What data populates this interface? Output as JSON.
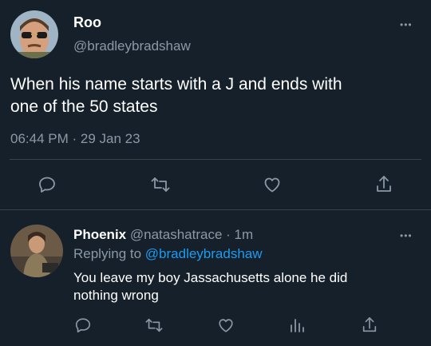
{
  "main_tweet": {
    "author_name": "Roo",
    "author_handle": "@bradleybradshaw",
    "text_line1": "When his name starts with a J and ends with",
    "text_line2": "one of the 50 states",
    "time": "06:44 PM",
    "separator": "·",
    "date": "29 Jan 23",
    "more_label": "•••"
  },
  "reply": {
    "author_name": "Phoenix",
    "author_handle": "@natashatrace",
    "separator": "·",
    "time_ago": "1m",
    "replying_prefix": "Replying to",
    "replying_to": "@bradleybradshaw",
    "text_line1": "You leave my boy Jassachusetts alone he did",
    "text_line2": "nothing wrong",
    "more_label": "•••"
  },
  "icons": {
    "reply": "reply-icon",
    "retweet": "retweet-icon",
    "like": "heart-icon",
    "share": "share-icon",
    "analytics": "analytics-icon"
  },
  "colors": {
    "background": "#15202b",
    "muted": "#8b98a5",
    "link": "#1d9bf0",
    "divider": "#38444d"
  }
}
